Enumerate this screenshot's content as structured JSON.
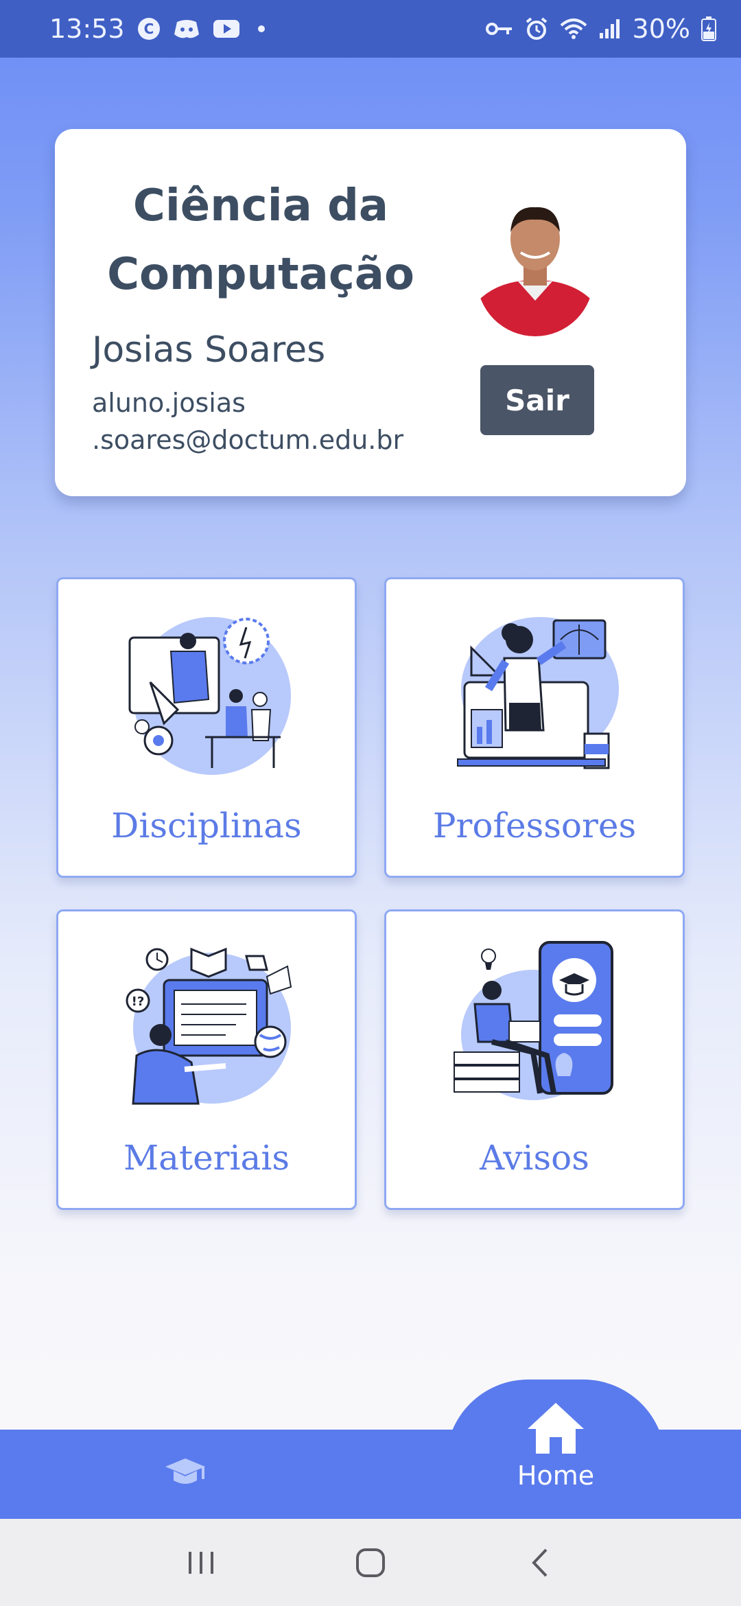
{
  "status_bar": {
    "time": "13:53",
    "battery": "30%",
    "left_icons": [
      "c-circle-icon",
      "discord-icon",
      "youtube-icon",
      "dot-icon"
    ],
    "right_icons": [
      "key-icon",
      "alarm-icon",
      "wifi-icon",
      "signal-icon",
      "battery-icon"
    ]
  },
  "profile": {
    "course_title": "Ciência da Computação",
    "student_name": "Josias Soares",
    "email": "aluno.josias\n.soares@doctum.edu.br",
    "logout_label": "Sair"
  },
  "tiles": [
    {
      "label": "Disciplinas",
      "icon": "classroom-illustration"
    },
    {
      "label": "Professores",
      "icon": "teacher-illustration"
    },
    {
      "label": "Materiais",
      "icon": "materials-illustration"
    },
    {
      "label": "Avisos",
      "icon": "notices-illustration"
    }
  ],
  "bottom_nav": {
    "items": [
      {
        "icon": "graduation-cap-icon",
        "label": ""
      },
      {
        "icon": "home-icon",
        "label": "Home"
      }
    ]
  },
  "colors": {
    "accent": "#5a7bed",
    "status_bar": "#3f5fc4",
    "text_dark": "#3d4e63",
    "button_dark": "#4a5567",
    "tile_label": "#5b7be6"
  }
}
